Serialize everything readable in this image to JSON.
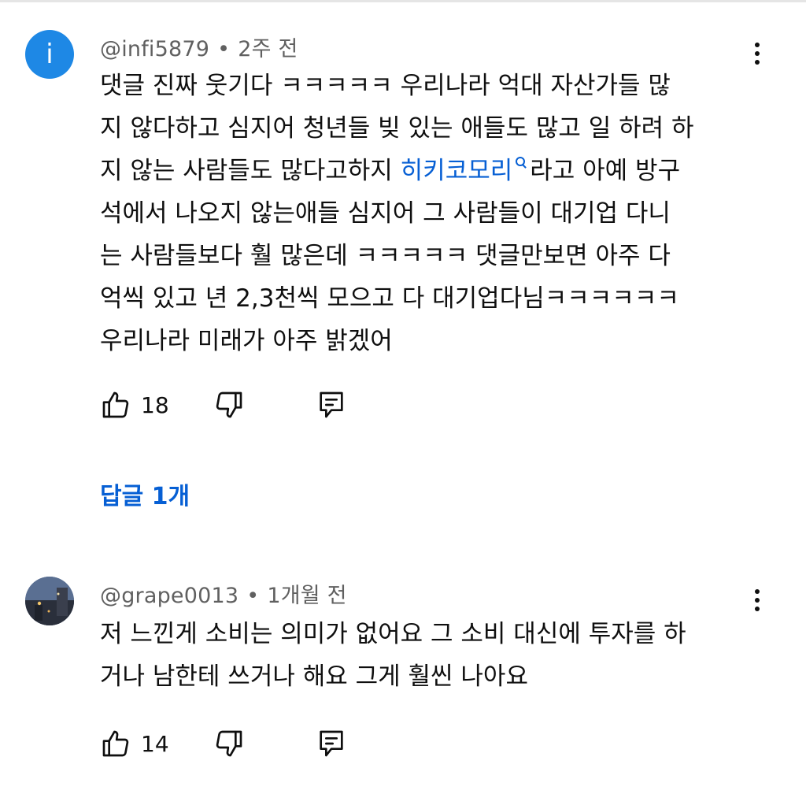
{
  "comments": [
    {
      "avatar_letter": "i",
      "avatar_color": "#1e88e5",
      "author": "@infi5879",
      "separator": "•",
      "time": "2주 전",
      "lines": [
        "댓글 진짜 웃기다 ㅋㅋㅋㅋㅋ 우리나라 억대 자산가들 많",
        "지 않다하고 심지어 청년들 빚 있는 애들도 많고 일 하려 하",
        "지 않는 사람들도 많다고하지 "
      ],
      "search_link": "히키코모리",
      "line3_after": "라고 아예 방구",
      "lines_rest": [
        "석에서 나오지 않는애들 심지어 그 사람들이 대기업 다니",
        "는 사람들보다 훨 많은데 ㅋㅋㅋㅋㅋ 댓글만보면 아주 다",
        "억씩 있고 년 2,3천씩 모으고 다 대기업다님ㅋㅋㅋㅋㅋㅋ",
        "우리나라 미래가 아주 밝겠어"
      ],
      "like_count": "18",
      "replies_label": "답글 1개"
    },
    {
      "author": "@grape0013",
      "separator": "•",
      "time": "1개월 전",
      "lines": [
        "저 느낀게 소비는 의미가 없어요 그 소비 대신에 투자를 하",
        "거나 남한테 쓰거나 해요 그게 훨씬 나아요"
      ],
      "like_count": "14"
    }
  ],
  "colors": {
    "link": "#065fd4",
    "meta": "#606060",
    "text": "#0f0f0f"
  },
  "icons": [
    "thumbs-up-icon",
    "thumbs-down-icon",
    "reply-icon",
    "more-vert-icon",
    "search-icon"
  ]
}
